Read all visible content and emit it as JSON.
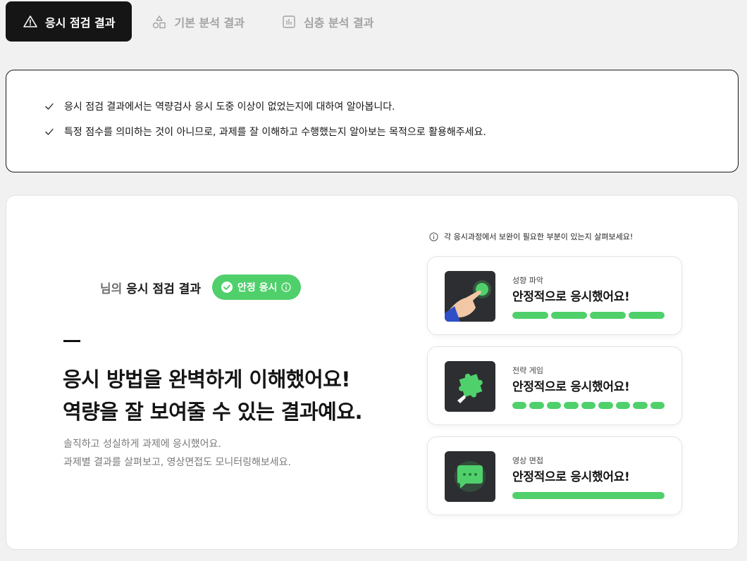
{
  "tabs": [
    {
      "label": "응시 점검 결과",
      "active": true,
      "icon": "warning-icon"
    },
    {
      "label": "기본 분석 결과",
      "active": false,
      "icon": "shapes-icon"
    },
    {
      "label": "심층 분석 결과",
      "active": false,
      "icon": "bar-chart-icon"
    }
  ],
  "info": {
    "items": [
      "응시 점검 결과에서는 역량검사 응시 도중 이상이 없었는지에 대하여 알아봅니다.",
      "특정 점수를 의미하는 것이 아니므로, 과제를 잘 이해하고 수행했는지 알아보는 목적으로 활용해주세요."
    ]
  },
  "result": {
    "owner_suffix": "님의",
    "title": "응시 점검 결과",
    "badge": "안정 응시",
    "headline_line1": "응시 방법을 완벽하게 이해했어요!",
    "headline_line2": "역량을 잘 보여줄 수 있는 결과예요.",
    "sub_line1": "솔직하고 성실하게 과제에 응시했어요.",
    "sub_line2": "과제별 결과를 살펴보고, 영상면접도 모니터링해보세요."
  },
  "hint": "각 응시과정에서 보완이 필요한 부분이 있는지 살펴보세요!",
  "tasks": [
    {
      "label": "성향 파악",
      "status": "안정적으로 응시했어요!",
      "segments": 4,
      "icon": "hand-pointer-icon"
    },
    {
      "label": "전략 게임",
      "status": "안정적으로 응시했어요!",
      "segments": 9,
      "icon": "puzzle-icon"
    },
    {
      "label": "영상 면접",
      "status": "안정적으로 응시했어요!",
      "segments": 1,
      "icon": "chat-bubble-icon"
    }
  ],
  "colors": {
    "accent": "#4fd06b",
    "dark": "#151515"
  }
}
